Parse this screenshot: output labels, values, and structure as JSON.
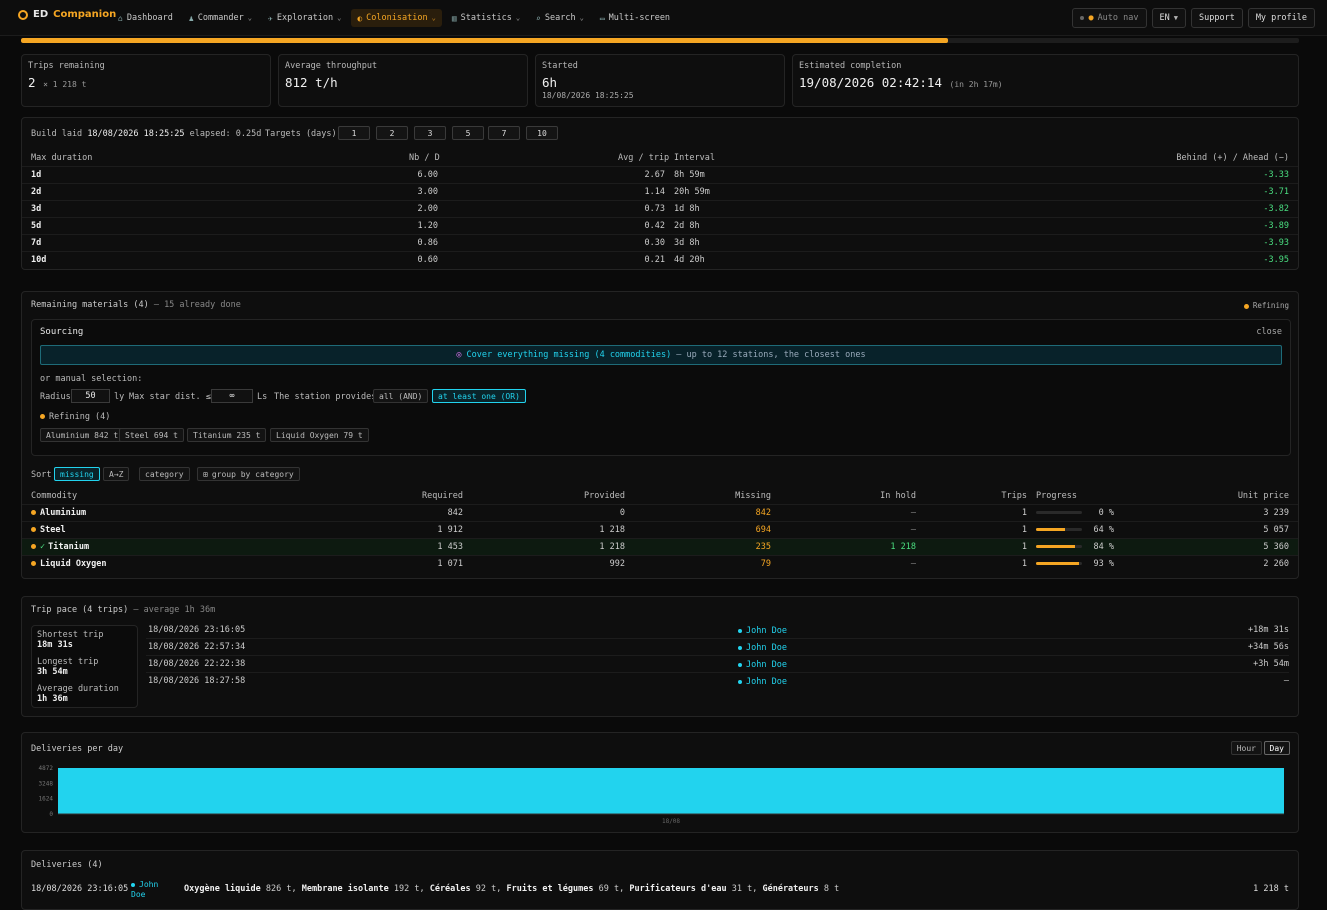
{
  "app": {
    "brand_prefix": "ED",
    "brand_accent": "Companion"
  },
  "nav": [
    {
      "icon": "home-icon",
      "label": "Dashboard",
      "caret": false,
      "active": false
    },
    {
      "icon": "commander-icon",
      "label": "Commander",
      "caret": true,
      "active": false
    },
    {
      "icon": "telescope-icon",
      "label": "Exploration",
      "caret": true,
      "active": false
    },
    {
      "icon": "planet-icon",
      "label": "Colonisation",
      "caret": true,
      "active": true
    },
    {
      "icon": "chart-icon",
      "label": "Statistics",
      "caret": true,
      "active": false
    },
    {
      "icon": "search-icon",
      "label": "Search",
      "caret": true,
      "active": false
    },
    {
      "icon": "monitor-icon",
      "label": "Multi-screen",
      "caret": false,
      "active": false
    }
  ],
  "top_right": {
    "auto_nav": "Auto nav",
    "lang": "EN",
    "support": "Support",
    "profile": "My profile"
  },
  "overall_progress": 0.725,
  "stats": {
    "trips": {
      "label": "Trips remaining",
      "value": "2",
      "detail": "× 1 218 t"
    },
    "throughput": {
      "label": "Average throughput",
      "value": "812 t/h"
    },
    "started": {
      "label": "Started",
      "value": "6h",
      "sub": "18/08/2026 18:25:25"
    },
    "completion": {
      "label": "Estimated completion",
      "value": "19/08/2026 02:42:14",
      "detail": "(in 2h 17m)"
    }
  },
  "targets": {
    "build_label": "Build laid",
    "build_date": "18/08/2026 18:25:25",
    "elapsed": "elapsed: 0.25d",
    "targets_label": "Targets (days)",
    "buttons": [
      "1",
      "2",
      "3",
      "5",
      "7",
      "10"
    ],
    "headers": {
      "max": "Max duration",
      "nb": "Nb / D",
      "avg": "Avg / trip",
      "interval": "Interval",
      "behind": "Behind (+) / Ahead (−)"
    },
    "rows": [
      {
        "max": "1d",
        "nb": "6.00",
        "avg": "2.67",
        "interval": "8h 59m",
        "behind": "-3.33"
      },
      {
        "max": "2d",
        "nb": "3.00",
        "avg": "1.14",
        "interval": "20h 59m",
        "behind": "-3.71"
      },
      {
        "max": "3d",
        "nb": "2.00",
        "avg": "0.73",
        "interval": "1d 8h",
        "behind": "-3.82"
      },
      {
        "max": "5d",
        "nb": "1.20",
        "avg": "0.42",
        "interval": "2d 8h",
        "behind": "-3.89"
      },
      {
        "max": "7d",
        "nb": "0.86",
        "avg": "0.30",
        "interval": "3d 8h",
        "behind": "-3.93"
      },
      {
        "max": "10d",
        "nb": "0.60",
        "avg": "0.21",
        "interval": "4d 20h",
        "behind": "-3.95"
      }
    ]
  },
  "materials": {
    "title": "Remaining materials (4)",
    "done": "— 15 already done",
    "legend": "Refining",
    "sourcing": {
      "title": "Sourcing",
      "close": "close",
      "cover_strong": "Cover everything missing (4 commodities)",
      "cover_rest": "— up to 12 stations, the closest ones",
      "manual": "or manual selection:",
      "radius_label": "Radius",
      "radius_value": "50",
      "radius_unit": "ly",
      "maxdist_label": "Max star dist. ≤",
      "maxdist_value": "∞",
      "maxdist_unit": "Ls",
      "provides_label": "The station provides",
      "opt_and": "all (AND)",
      "opt_or": "at least one (OR)",
      "refining_label": "Refining (4)",
      "chips": [
        "Aluminium 842 t",
        "Steel 694 t",
        "Titanium 235 t",
        "Liquid Oxygen 79 t"
      ]
    },
    "sort": {
      "label": "Sort",
      "options": [
        "missing",
        "A→Z",
        "category"
      ],
      "group": "group by category"
    },
    "headers": {
      "commodity": "Commodity",
      "required": "Required",
      "provided": "Provided",
      "missing": "Missing",
      "hold": "In hold",
      "trips": "Trips",
      "progress": "Progress",
      "price": "Unit price"
    },
    "rows": [
      {
        "name": "Aluminium",
        "check": "",
        "required": "842",
        "provided": "0",
        "missing": "842",
        "hold": "–",
        "trips": "1",
        "progress": 0,
        "progress_label": "0 %",
        "price": "3 239"
      },
      {
        "name": "Steel",
        "check": "",
        "required": "1 912",
        "provided": "1 218",
        "missing": "694",
        "hold": "–",
        "trips": "1",
        "progress": 64,
        "progress_label": "64 %",
        "price": "5 057"
      },
      {
        "name": "Titanium",
        "check": "✓",
        "required": "1 453",
        "provided": "1 218",
        "missing": "235",
        "hold": "1 218",
        "trips": "1",
        "progress": 84,
        "progress_label": "84 %",
        "price": "5 360"
      },
      {
        "name": "Liquid Oxygen",
        "check": "",
        "required": "1 071",
        "provided": "992",
        "missing": "79",
        "hold": "–",
        "trips": "1",
        "progress": 93,
        "progress_label": "93 %",
        "price": "2 260"
      }
    ]
  },
  "pace": {
    "title": "Trip pace (4 trips)",
    "avg": "— average 1h 36m",
    "summary": [
      {
        "label": "Shortest trip",
        "value": "18m 31s"
      },
      {
        "label": "Longest trip",
        "value": "3h 54m"
      },
      {
        "label": "Average duration",
        "value": "1h 36m"
      }
    ],
    "rows": [
      {
        "date": "18/08/2026 23:16:05",
        "who": "John Doe",
        "delta": "+18m 31s"
      },
      {
        "date": "18/08/2026 22:57:34",
        "who": "John Doe",
        "delta": "+34m 56s"
      },
      {
        "date": "18/08/2026 22:22:38",
        "who": "John Doe",
        "delta": "+3h 54m"
      },
      {
        "date": "18/08/2026 18:27:58",
        "who": "John Doe",
        "delta": "–"
      }
    ]
  },
  "deliveries_chart": {
    "title": "Deliveries per day",
    "toggle": [
      "Hour",
      "Day"
    ],
    "active": "Day",
    "yticks": [
      "4872",
      "3248",
      "1624",
      "0"
    ],
    "xtick": "18/08",
    "bar_color": "#22d3ee",
    "value": 4872
  },
  "deliveries": {
    "title": "Deliveries (4)",
    "first": {
      "date": "18/08/2026 23:16:05",
      "who": "John Doe",
      "items": [
        {
          "name": "Oxygène liquide",
          "qty": "826 t"
        },
        {
          "name": "Membrane isolante",
          "qty": "192 t"
        },
        {
          "name": "Céréales",
          "qty": "92 t"
        },
        {
          "name": "Fruits et légumes",
          "qty": "69 t"
        },
        {
          "name": "Purificateurs d'eau",
          "qty": "31 t"
        },
        {
          "name": "Générateurs",
          "qty": "8 t"
        }
      ],
      "total": "1 218 t"
    }
  }
}
